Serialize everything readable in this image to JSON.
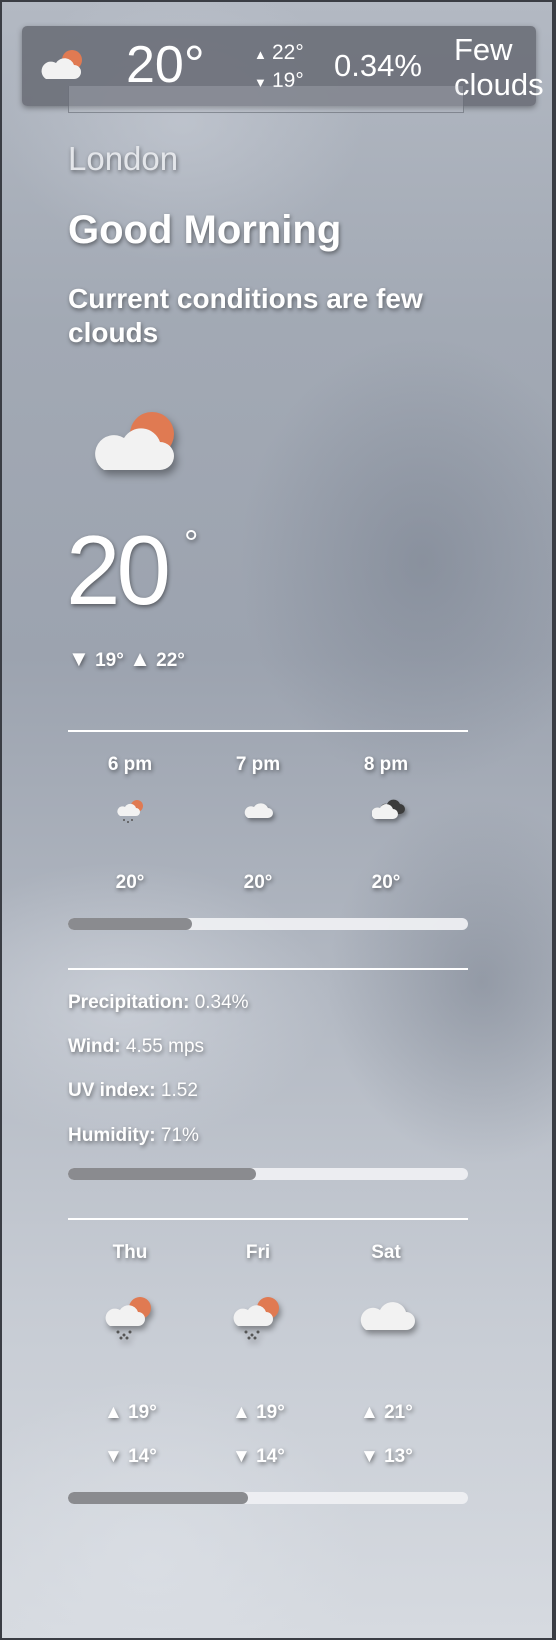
{
  "topbar": {
    "icon": "few-clouds-icon",
    "temp": "20°",
    "high": "22°",
    "low": "19°",
    "precipitation": "0.34%",
    "description": "Few clouds"
  },
  "location": {
    "city": "London"
  },
  "greeting": "Good Morning",
  "conditions": "Current conditions are few clouds",
  "current": {
    "icon": "few-clouds-icon",
    "temp": "20",
    "degree": "°",
    "low": "19°",
    "high": "22°"
  },
  "hourly": [
    {
      "time": "6 pm",
      "icon": "few-clouds-rain-icon",
      "temp": "20°"
    },
    {
      "time": "7 pm",
      "icon": "cloud-icon",
      "temp": "20°"
    },
    {
      "time": "8 pm",
      "icon": "dark-clouds-icon",
      "temp": "20°"
    }
  ],
  "hourly_scroll_position": 0.31,
  "details": {
    "precipitation_label": "Precipitation:",
    "precipitation_value": "0.34%",
    "wind_label": "Wind:",
    "wind_value": "4.55 mps",
    "uv_label": "UV index:",
    "uv_value": "1.52",
    "humidity_label": "Humidity:",
    "humidity_value": "71%"
  },
  "details_scroll_position": 0.47,
  "daily": [
    {
      "day": "Thu",
      "icon": "few-clouds-rain-icon",
      "high": "19°",
      "low": "14°"
    },
    {
      "day": "Fri",
      "icon": "few-clouds-rain-icon",
      "high": "19°",
      "low": "14°"
    },
    {
      "day": "Sat",
      "icon": "cloud-icon",
      "high": "21°",
      "low": "13°"
    }
  ],
  "daily_scroll_position": 0.45,
  "colors": {
    "sun": "#e07a52",
    "cloud": "#f2f2f2",
    "dark_cloud": "#3c3c3c",
    "track": "#eeeff2",
    "track_fill": "#8a8b8f",
    "topbar_bg": "#6c707a"
  }
}
